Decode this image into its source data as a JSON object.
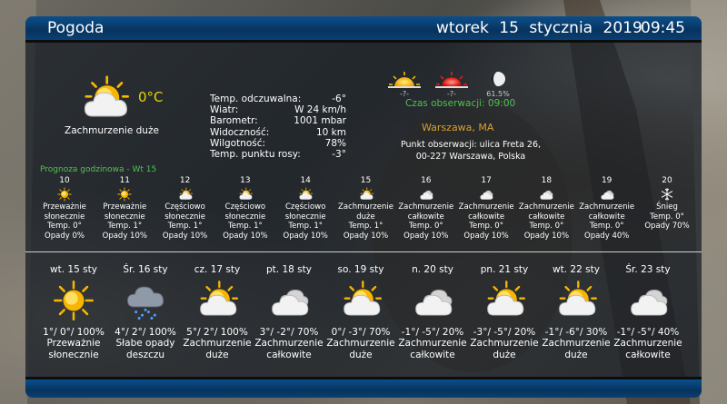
{
  "header": {
    "title": "Pogoda",
    "date": "wtorek 15 stycznia 2019",
    "time": "09:45"
  },
  "current": {
    "temp": "0°C",
    "condition": "Zachmurzenie duże",
    "icon": "sun-cloud-icon",
    "details": [
      {
        "label": "Temp. odczuwalna:",
        "value": "-6°"
      },
      {
        "label": "Wiatr:",
        "value": "W 24 km/h"
      },
      {
        "label": "Barometr:",
        "value": "1001 mbar"
      },
      {
        "label": "Widoczność:",
        "value": "10 km"
      },
      {
        "label": "Wilgotność:",
        "value": "78%"
      },
      {
        "label": "Temp. punktu rosy:",
        "value": "-3°"
      }
    ]
  },
  "astro": {
    "sunrise": "-?-",
    "sunset": "-?-",
    "moon": "61.5%",
    "observation_time": "Czas obserwacji: 09:00",
    "location": "Warszawa, MA",
    "station_line1": "Punkt obserwacji: ulica Freta 26,",
    "station_line2": "00-227 Warszawa, Polska"
  },
  "hourly_title": "Prognoza godzinowa - Wt 15",
  "hourly": [
    {
      "hour": "10",
      "icon": "sun-icon",
      "cond1": "Przeważnie",
      "cond2": "słonecznie",
      "temp": "Temp. 0°",
      "precip": "Opady 0%"
    },
    {
      "hour": "11",
      "icon": "sun-icon",
      "cond1": "Przeważnie",
      "cond2": "słonecznie",
      "temp": "Temp. 1°",
      "precip": "Opady 10%"
    },
    {
      "hour": "12",
      "icon": "sun-cloud-icon",
      "cond1": "Częściowo",
      "cond2": "słonecznie",
      "temp": "Temp. 1°",
      "precip": "Opady 10%"
    },
    {
      "hour": "13",
      "icon": "sun-cloud-icon",
      "cond1": "Częściowo",
      "cond2": "słonecznie",
      "temp": "Temp. 1°",
      "precip": "Opady 10%"
    },
    {
      "hour": "14",
      "icon": "sun-cloud-icon",
      "cond1": "Częściowo",
      "cond2": "słonecznie",
      "temp": "Temp. 1°",
      "precip": "Opady 10%"
    },
    {
      "hour": "15",
      "icon": "sun-cloud-icon",
      "cond1": "Zachmurzenie",
      "cond2": "duże",
      "temp": "Temp. 1°",
      "precip": "Opady 10%"
    },
    {
      "hour": "16",
      "icon": "cloud-icon",
      "cond1": "Zachmurzenie",
      "cond2": "całkowite",
      "temp": "Temp. 0°",
      "precip": "Opady 10%"
    },
    {
      "hour": "17",
      "icon": "cloud-icon",
      "cond1": "Zachmurzenie",
      "cond2": "całkowite",
      "temp": "Temp. 0°",
      "precip": "Opady 10%"
    },
    {
      "hour": "18",
      "icon": "cloud-icon",
      "cond1": "Zachmurzenie",
      "cond2": "całkowite",
      "temp": "Temp. 0°",
      "precip": "Opady 10%"
    },
    {
      "hour": "19",
      "icon": "cloud-icon",
      "cond1": "Zachmurzenie",
      "cond2": "całkowite",
      "temp": "Temp. 0°",
      "precip": "Opady 40%"
    },
    {
      "hour": "20",
      "icon": "snowflake-icon",
      "cond1": "Śnieg",
      "cond2": "",
      "temp": "Temp. 0°",
      "precip": "Opady 70%"
    }
  ],
  "daily": [
    {
      "day": "wt. 15 sty",
      "icon": "sun-icon",
      "temps": "1°/ 0°/ 100%",
      "cond1": "Przeważnie",
      "cond2": "słonecznie"
    },
    {
      "day": "Śr. 16 sty",
      "icon": "rain-cloud-icon",
      "temps": "4°/ 2°/ 100%",
      "cond1": "Słabe opady",
      "cond2": "deszczu"
    },
    {
      "day": "cz. 17 sty",
      "icon": "sun-cloud-icon",
      "temps": "5°/ 2°/ 100%",
      "cond1": "Zachmurzenie",
      "cond2": "duże"
    },
    {
      "day": "pt. 18 sty",
      "icon": "cloud-icon",
      "temps": "3°/ -2°/ 70%",
      "cond1": "Zachmurzenie",
      "cond2": "całkowite"
    },
    {
      "day": "so. 19 sty",
      "icon": "sun-cloud-icon",
      "temps": "0°/ -3°/ 70%",
      "cond1": "Zachmurzenie",
      "cond2": "duże"
    },
    {
      "day": "n. 20 sty",
      "icon": "cloud-icon",
      "temps": "-1°/ -5°/ 20%",
      "cond1": "Zachmurzenie",
      "cond2": "całkowite"
    },
    {
      "day": "pn. 21 sty",
      "icon": "sun-cloud-icon",
      "temps": "-3°/ -5°/ 20%",
      "cond1": "Zachmurzenie",
      "cond2": "duże"
    },
    {
      "day": "wt. 22 sty",
      "icon": "sun-cloud-icon",
      "temps": "-1°/ -6°/ 30%",
      "cond1": "Zachmurzenie",
      "cond2": "duże"
    },
    {
      "day": "Śr. 23 sty",
      "icon": "cloud-icon",
      "temps": "-1°/ -5°/ 40%",
      "cond1": "Zachmurzenie",
      "cond2": "całkowite"
    }
  ]
}
